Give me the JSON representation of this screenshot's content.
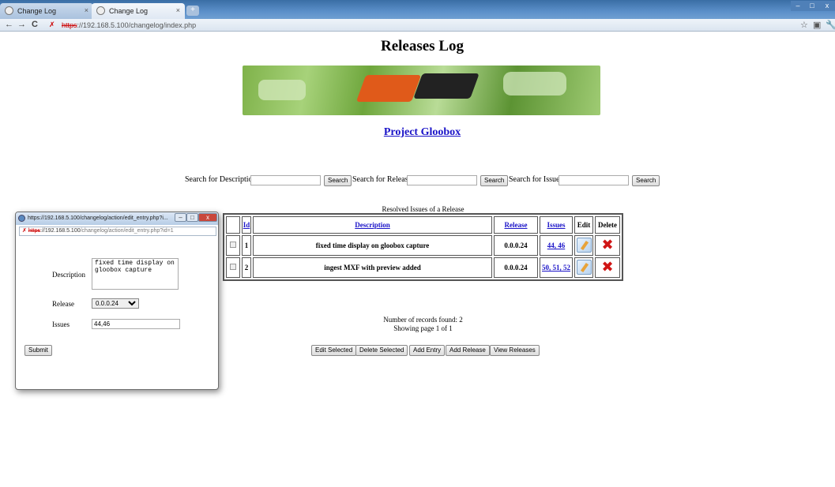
{
  "browser": {
    "tabs": [
      {
        "label": "Change Log",
        "active": false
      },
      {
        "label": "Change Log",
        "active": true
      }
    ],
    "new_tab_icon": "+",
    "window_controls": {
      "minimize": "–",
      "maximize": "□",
      "close": "x"
    },
    "nav": {
      "back": "←",
      "forward": "→",
      "reload": "C"
    },
    "address": {
      "scheme": "https",
      "rest": "://192.168.5.100/changelog/index.php"
    },
    "toolbar_right": [
      "☆",
      "▣",
      "🔧"
    ]
  },
  "page": {
    "title": "Releases Log",
    "project_link": "Project Gloobox"
  },
  "search": {
    "description_label": "Search for Description:",
    "release_label": "Search for Release:",
    "issues_label": "Search for Issues:",
    "button_label": "Search",
    "description_value": "",
    "release_value": "",
    "issues_value": ""
  },
  "table": {
    "caption": "Resolved Issues of a Release",
    "headers": {
      "id": "Id",
      "description": "Description",
      "release": "Release",
      "issues": "Issues",
      "edit": "Edit",
      "delete": "Delete"
    },
    "rows": [
      {
        "id": "1",
        "description": "fixed time display on gloobox capture",
        "release": "0.0.0.24",
        "issues": "44, 46"
      },
      {
        "id": "2",
        "description": "ingest MXF with preview added",
        "release": "0.0.0.24",
        "issues": "50, 51, 52"
      }
    ],
    "edit_icon": "edit-icon",
    "delete_icon": "delete-icon",
    "delete_glyph": "✖"
  },
  "records": {
    "count_text": "Number of records found: 2",
    "page_text": "Showing page 1 of 1"
  },
  "actions": {
    "edit_selected": "Edit Selected",
    "delete_selected": "Delete Selected",
    "add_entry": "Add Entry",
    "add_release": "Add Release",
    "view_releases": "View Releases"
  },
  "popup": {
    "title": "https://192.168.5.100/changelog/action/edit_entry.php?i...",
    "address": {
      "scheme": "https",
      "host": "://192.168.5.100",
      "path": "/changelog/action/edit_entry.php?id=1"
    },
    "window_controls": {
      "minimize": "–",
      "maximize": "□",
      "close": "x"
    },
    "description_label": "Description",
    "description_value": "fixed time display on gloobox capture",
    "release_label": "Release",
    "release_value": "0.0.0.24",
    "issues_label": "Issues",
    "issues_value": "44,46",
    "submit_label": "Submit"
  }
}
